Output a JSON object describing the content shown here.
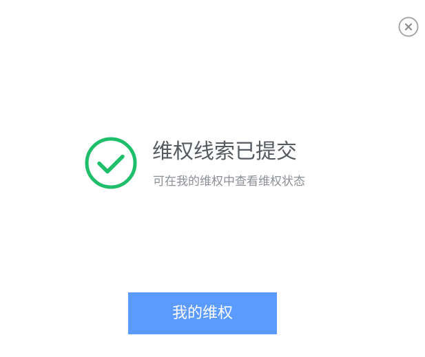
{
  "dialog": {
    "title": "维权线索已提交",
    "subtitle": "可在我的维权中查看维权状态",
    "primary_button_label": "我的维权",
    "icons": {
      "close": "close-circle-icon",
      "success": "check-circle-icon"
    }
  },
  "colors": {
    "success_green": "#1fbe6a",
    "button_blue": "#5b9bff",
    "title_text": "#555a60",
    "subtitle_text": "#8b8f94",
    "close_gray": "#a6a6a6"
  }
}
